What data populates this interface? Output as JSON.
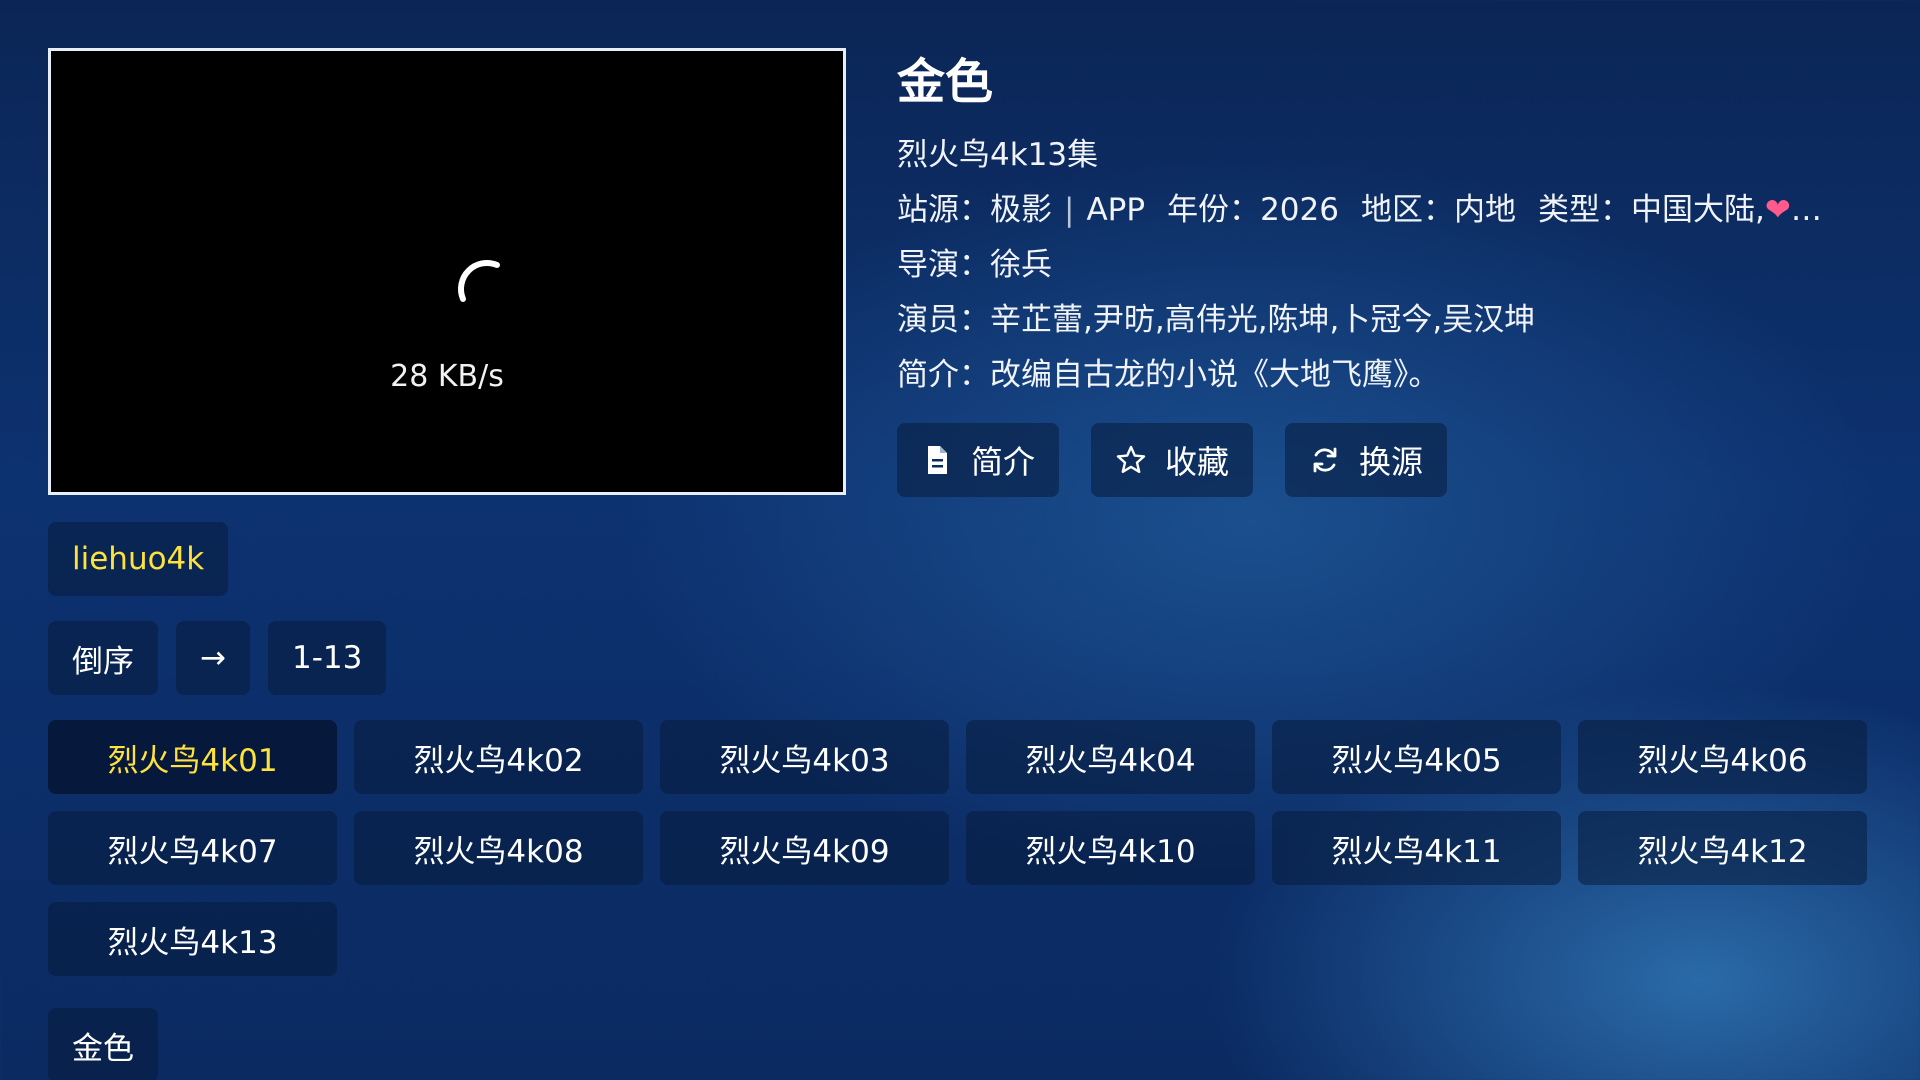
{
  "player": {
    "speed": "28 KB/s",
    "spinner_icon": "loading-spinner-icon"
  },
  "detail": {
    "title": "金色",
    "subtitle": "烈火鸟4k13集",
    "site_label": "站源：",
    "site_value": "极影",
    "site_sep": "|",
    "site_extra": "APP",
    "year_label": "年份：",
    "year_value": "2026",
    "region_label": "地区：",
    "region_value": "内地",
    "type_label": "类型：",
    "type_value": "中国大陆,",
    "type_more": "…",
    "director_label": "导演：",
    "director_value": "徐兵",
    "actors_label": "演员：",
    "actors_value": "辛芷蕾,尹昉,高伟光,陈坤,卜冠今,吴汉坤",
    "intro_label": "简介：",
    "intro_value": "改编自古龙的小说《大地飞鹰》。"
  },
  "actions": {
    "intro": "简介",
    "favorite": "收藏",
    "switch_source": "换源"
  },
  "source_tag": "liehuo4k",
  "controls": {
    "reverse": "倒序",
    "arrow": "→",
    "range": "1-13"
  },
  "episodes": [
    "烈火鸟4k01",
    "烈火鸟4k02",
    "烈火鸟4k03",
    "烈火鸟4k04",
    "烈火鸟4k05",
    "烈火鸟4k06",
    "烈火鸟4k07",
    "烈火鸟4k08",
    "烈火鸟4k09",
    "烈火鸟4k10",
    "烈火鸟4k11",
    "烈火鸟4k12",
    "烈火鸟4k13"
  ],
  "active_episode": 0,
  "bottom_tag": "金色",
  "colors": {
    "accent": "#ffe23d",
    "heart": "#ff5a8c"
  }
}
